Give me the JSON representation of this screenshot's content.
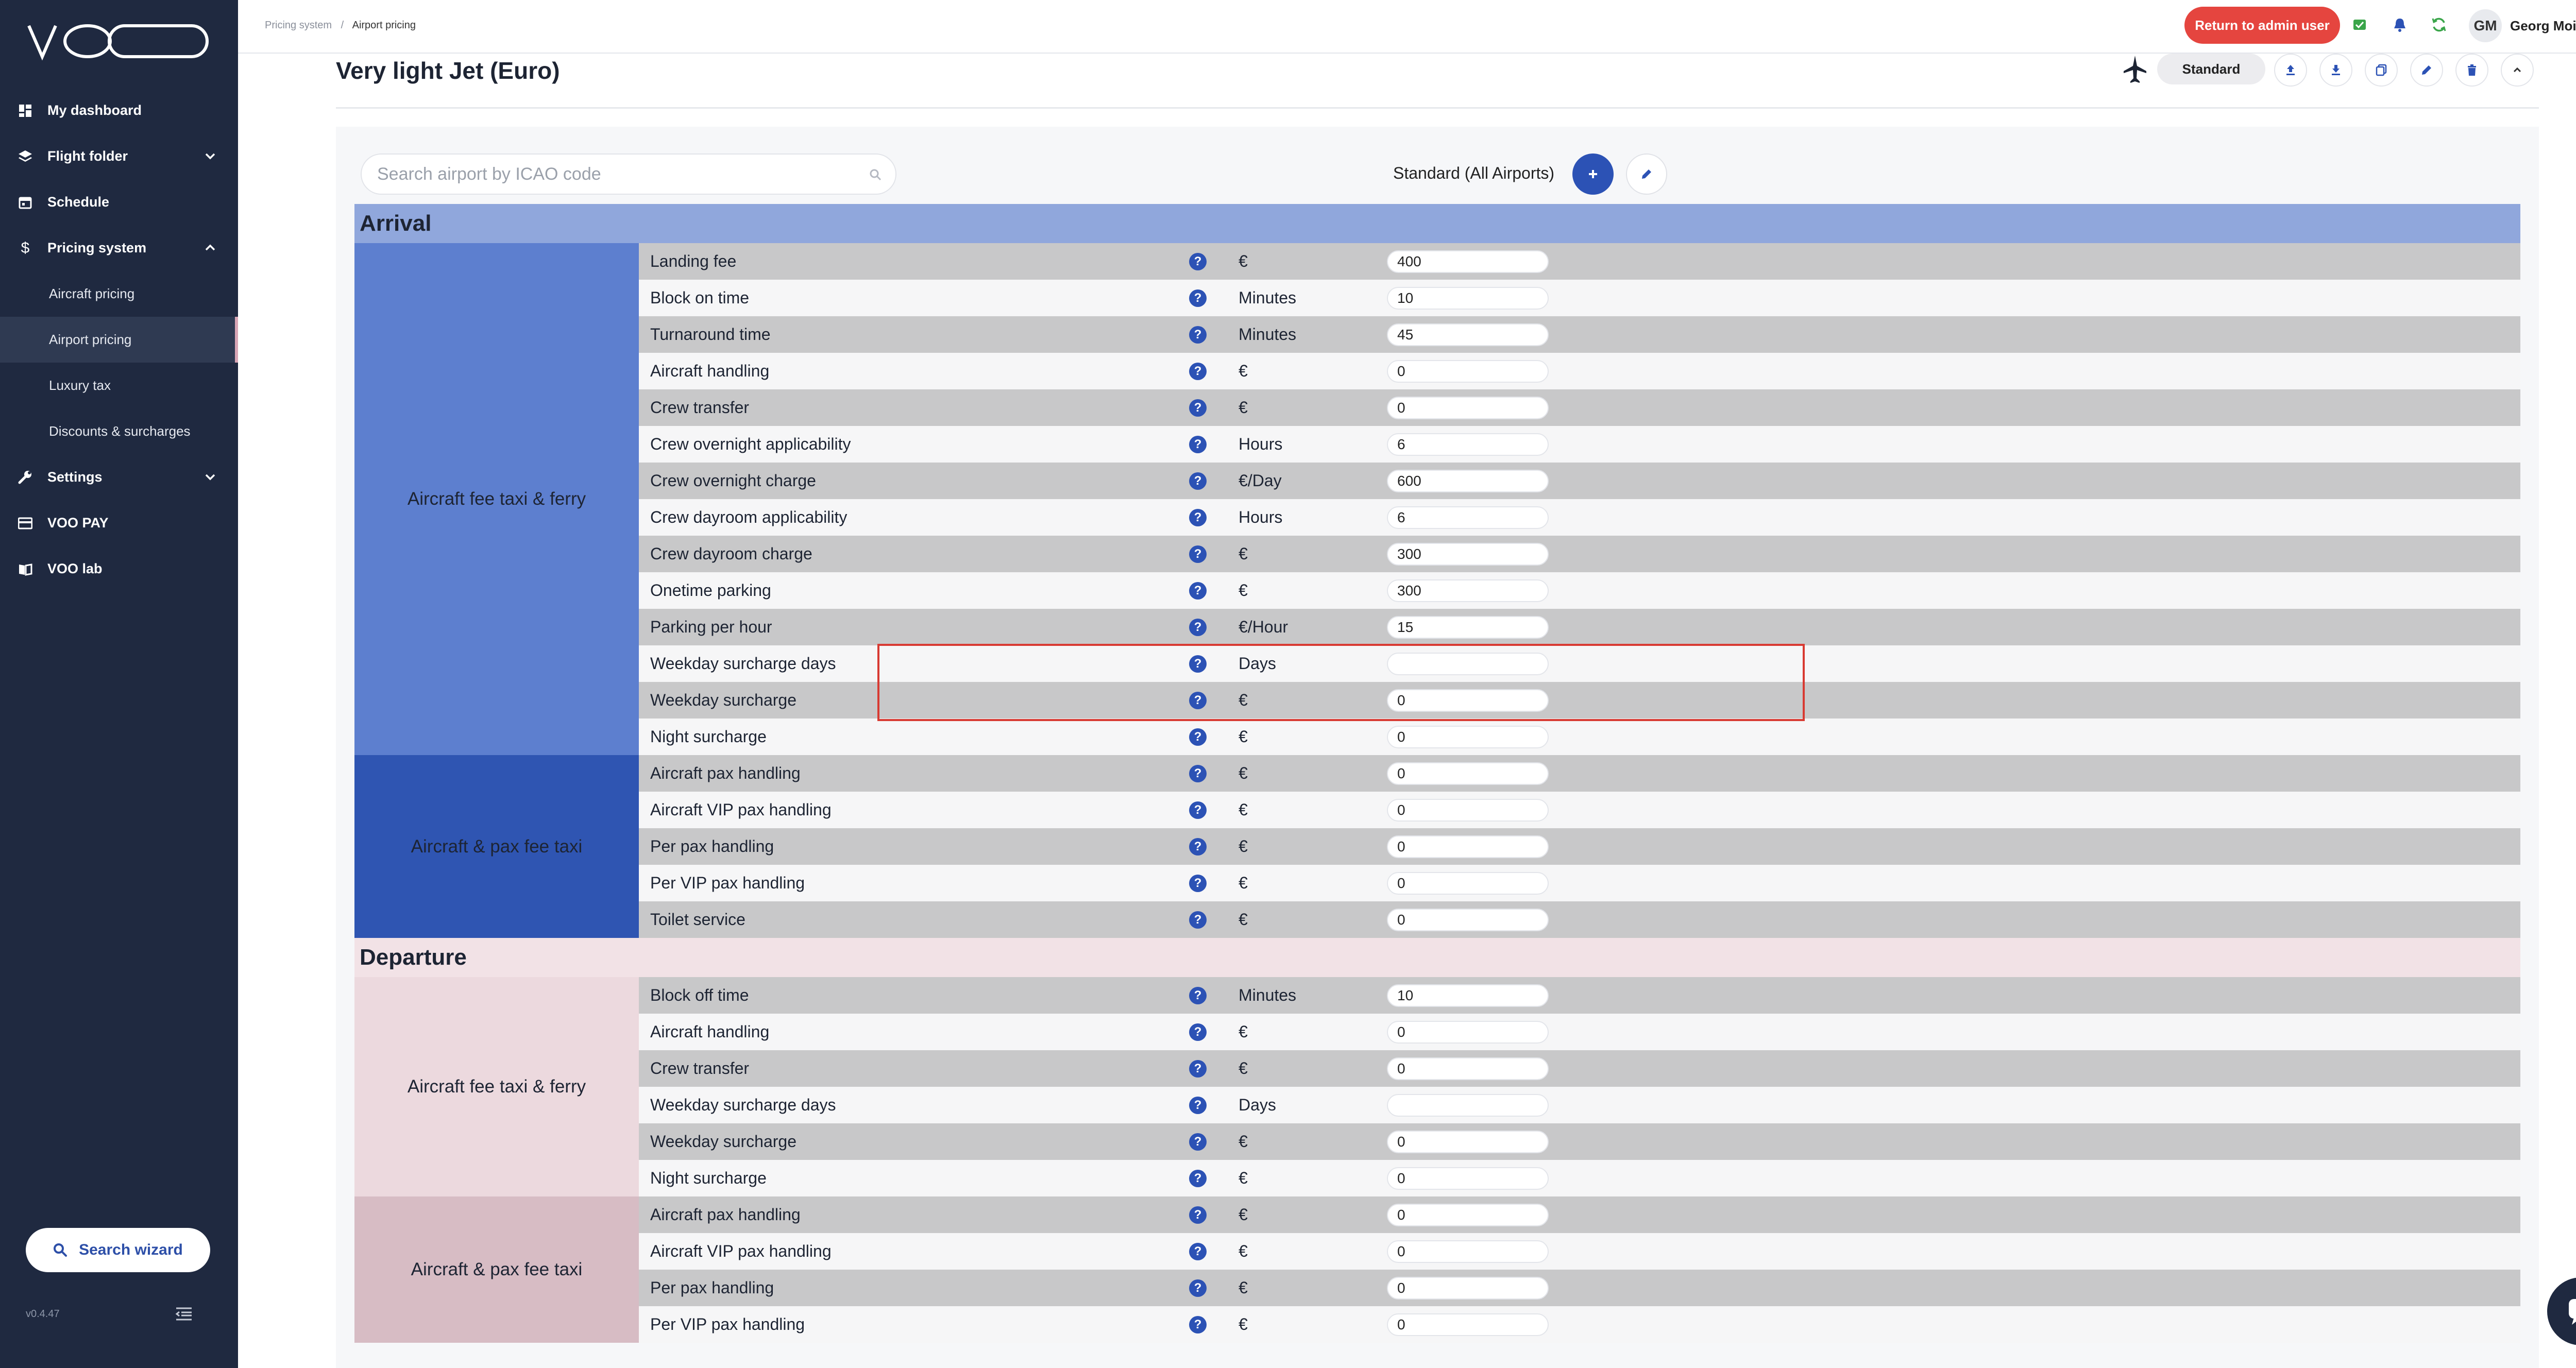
{
  "app": {
    "logo_text": "VOO",
    "version": "v0.4.47"
  },
  "sidebar": {
    "items": [
      {
        "label": "My dashboard",
        "icon": "dashboard-icon"
      },
      {
        "label": "Flight folder",
        "icon": "layers-icon"
      },
      {
        "label": "Schedule",
        "icon": "calendar-icon"
      },
      {
        "label": "Pricing system",
        "icon": "dollar-icon"
      }
    ],
    "pricing_sub": [
      {
        "label": "Aircraft pricing"
      },
      {
        "label": "Airport pricing"
      },
      {
        "label": "Luxury tax"
      },
      {
        "label": "Discounts & surcharges"
      }
    ],
    "bottom_items": [
      {
        "label": "Settings",
        "icon": "wrench-icon"
      },
      {
        "label": "VOO PAY",
        "icon": "card-icon"
      },
      {
        "label": "VOO lab",
        "icon": "book-icon"
      }
    ],
    "search_wizard": "Search wizard"
  },
  "topbar": {
    "breadcrumb_parent": "Pricing system",
    "breadcrumb_sep": "/",
    "breadcrumb_current": "Airport pricing",
    "return_admin": "Return to admin user",
    "avatar_initials": "GM",
    "username": "Georg Moik"
  },
  "page": {
    "title": "Very light Jet (Euro)",
    "profile_pill": "Standard",
    "search_placeholder": "Search airport by ICAO code",
    "standard_label": "Standard (All Airports)"
  },
  "table": {
    "arrival_title": "Arrival",
    "departure_title": "Departure",
    "groups": {
      "arr_taxi_ferry": "Aircraft fee taxi & ferry",
      "arr_pax": "Aircraft & pax fee taxi",
      "dep_taxi_ferry": "Aircraft fee taxi & ferry",
      "dep_pax": "Aircraft & pax fee taxi"
    },
    "help_glyph": "?",
    "arrival_rows": [
      {
        "label": "Landing fee",
        "unit": "€",
        "value": "400"
      },
      {
        "label": "Block on time",
        "unit": "Minutes",
        "value": "10"
      },
      {
        "label": "Turnaround time",
        "unit": "Minutes",
        "value": "45"
      },
      {
        "label": "Aircraft handling",
        "unit": "€",
        "value": "0"
      },
      {
        "label": "Crew transfer",
        "unit": "€",
        "value": "0"
      },
      {
        "label": "Crew overnight applicability",
        "unit": "Hours",
        "value": "6"
      },
      {
        "label": "Crew overnight charge",
        "unit": "€/Day",
        "value": "600"
      },
      {
        "label": "Crew dayroom applicability",
        "unit": "Hours",
        "value": "6"
      },
      {
        "label": "Crew dayroom charge",
        "unit": "€",
        "value": "300"
      },
      {
        "label": "Onetime parking",
        "unit": "€",
        "value": "300"
      },
      {
        "label": "Parking per hour",
        "unit": "€/Hour",
        "value": "15"
      },
      {
        "label": "Weekday surcharge days",
        "unit": "Days",
        "value": ""
      },
      {
        "label": "Weekday surcharge",
        "unit": "€",
        "value": "0"
      },
      {
        "label": "Night surcharge",
        "unit": "€",
        "value": "0"
      },
      {
        "label": "Aircraft pax handling",
        "unit": "€",
        "value": "0"
      },
      {
        "label": "Aircraft VIP pax handling",
        "unit": "€",
        "value": "0"
      },
      {
        "label": "Per pax handling",
        "unit": "€",
        "value": "0"
      },
      {
        "label": "Per VIP pax handling",
        "unit": "€",
        "value": "0"
      },
      {
        "label": "Toilet service",
        "unit": "€",
        "value": "0"
      }
    ],
    "departure_rows": [
      {
        "label": "Block off time",
        "unit": "Minutes",
        "value": "10"
      },
      {
        "label": "Aircraft handling",
        "unit": "€",
        "value": "0"
      },
      {
        "label": "Crew transfer",
        "unit": "€",
        "value": "0"
      },
      {
        "label": "Weekday surcharge days",
        "unit": "Days",
        "value": ""
      },
      {
        "label": "Weekday surcharge",
        "unit": "€",
        "value": "0"
      },
      {
        "label": "Night surcharge",
        "unit": "€",
        "value": "0"
      },
      {
        "label": "Aircraft pax handling",
        "unit": "€",
        "value": "0"
      },
      {
        "label": "Aircraft VIP pax handling",
        "unit": "€",
        "value": "0"
      },
      {
        "label": "Per pax handling",
        "unit": "€",
        "value": "0"
      },
      {
        "label": "Per VIP pax handling",
        "unit": "€",
        "value": "0"
      }
    ]
  },
  "colors": {
    "sidebar_bg": "#1f2940",
    "accent_blue": "#2c52b5",
    "arrival_header": "#90a7dc",
    "arrival_group1": "#5d7fcf",
    "arrival_group2": "#2f55b2",
    "departure_header": "#f2e2e6",
    "departure_group1": "#ecd9de",
    "departure_group2": "#d7bcc4",
    "admin_red": "#e5453f",
    "highlight_red": "#d83a32"
  }
}
